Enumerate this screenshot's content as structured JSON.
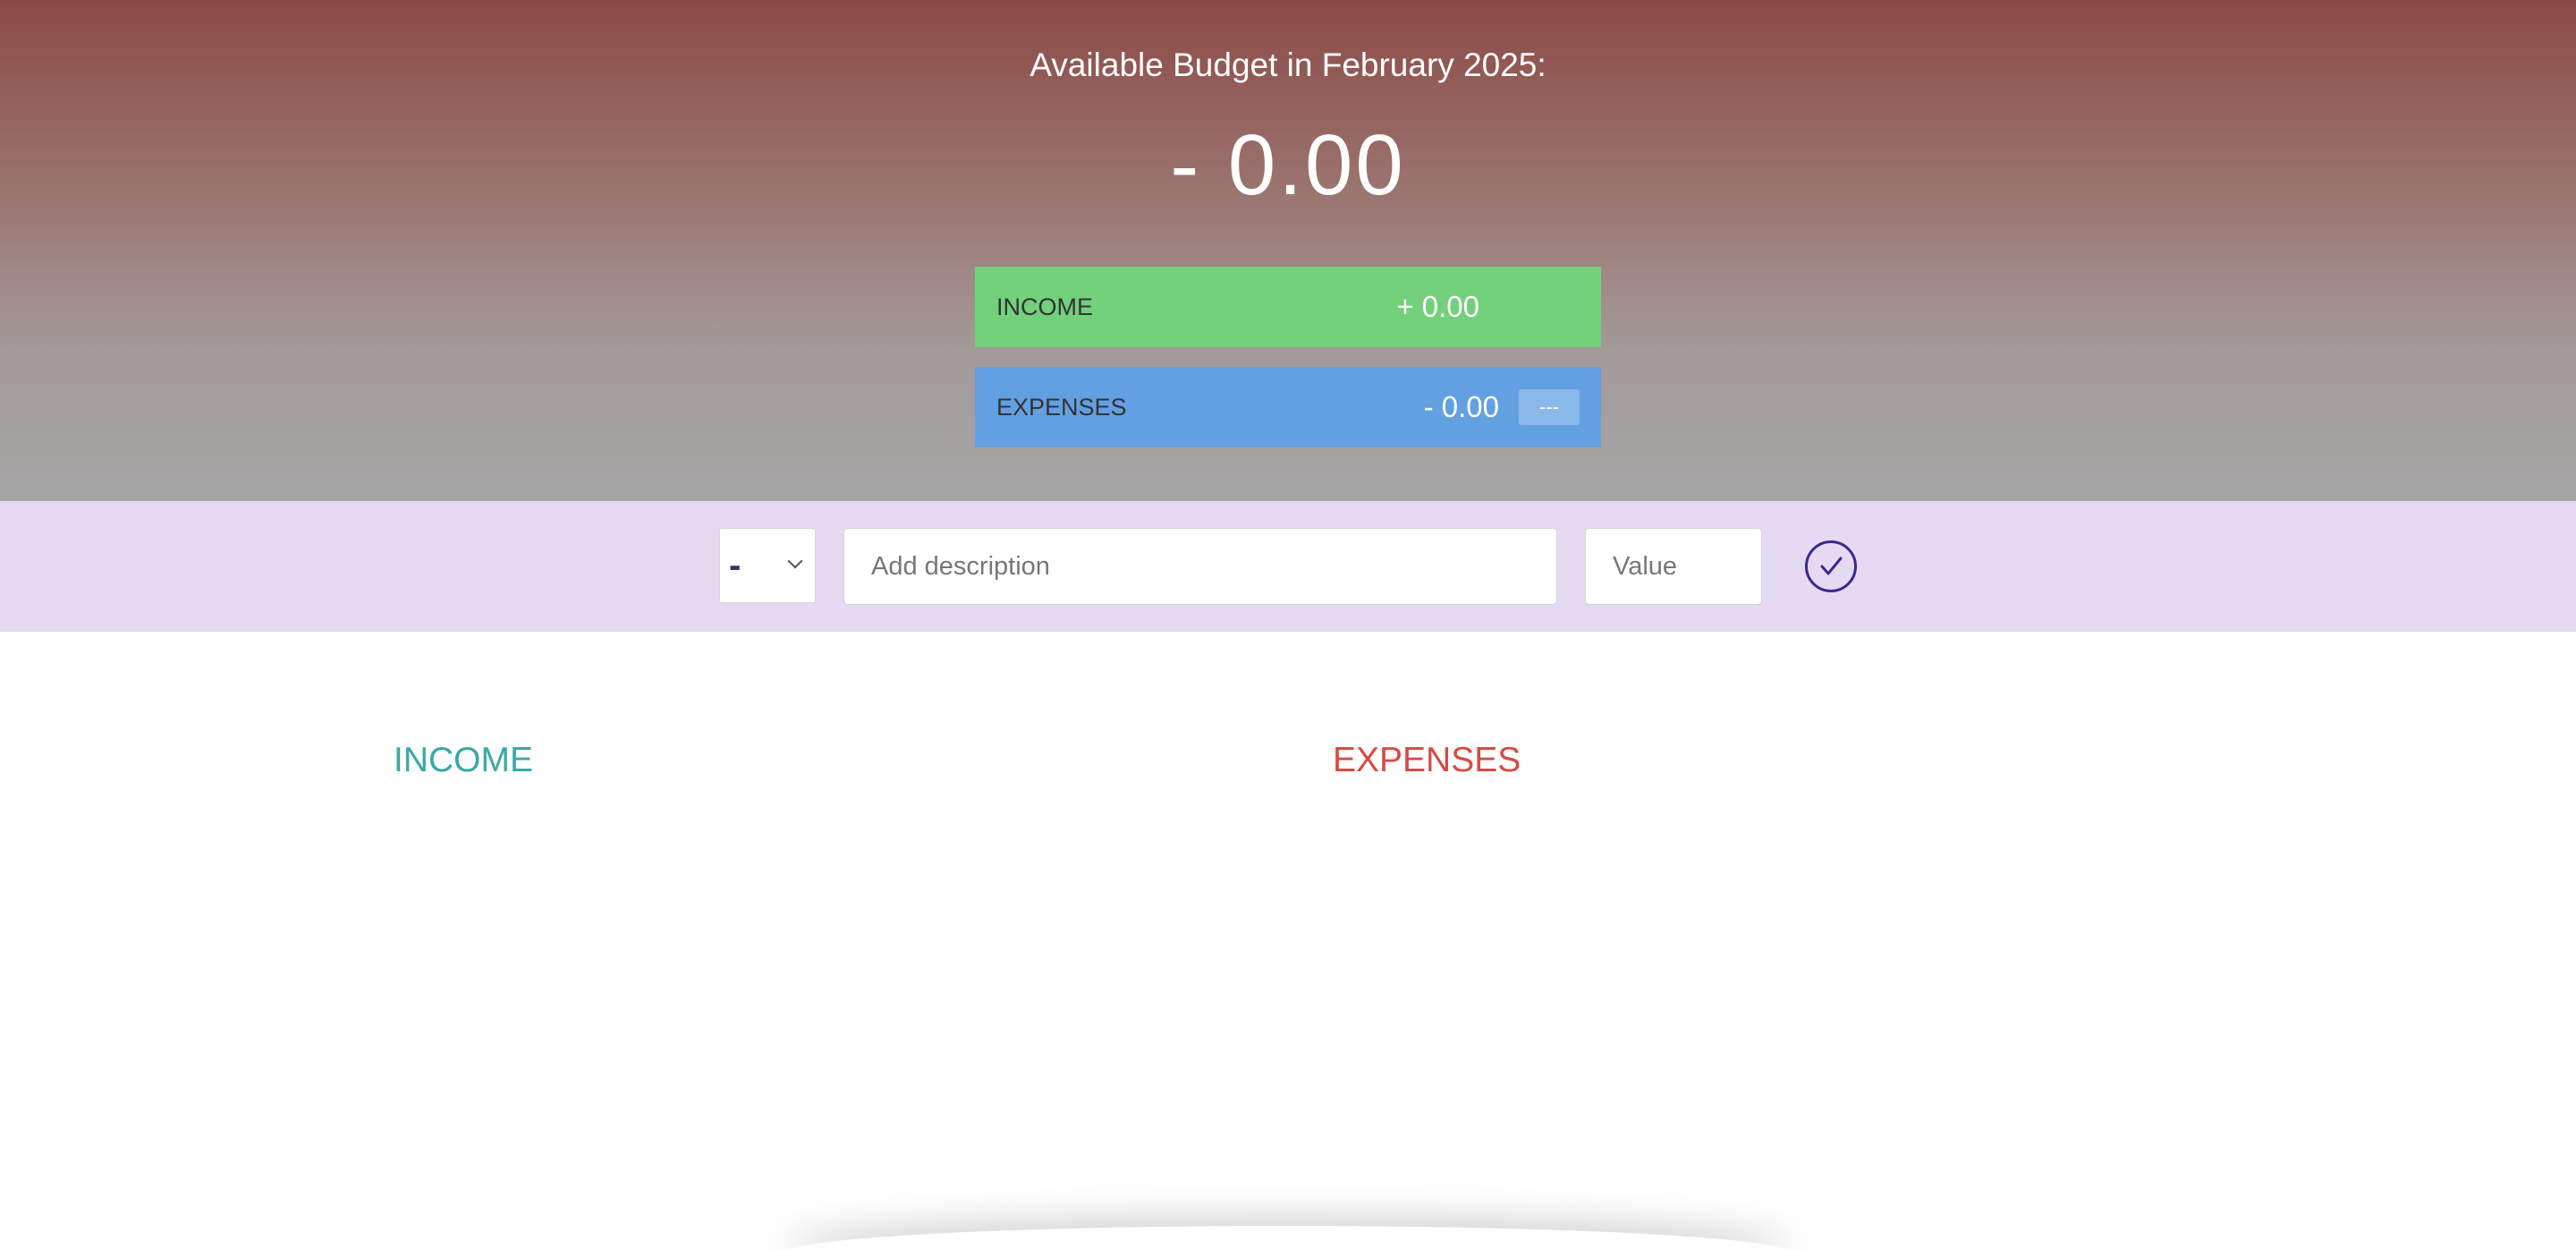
{
  "header": {
    "title": "Available Budget in February 2025:",
    "budget_value": "- 0.00"
  },
  "summary": {
    "income": {
      "label": "INCOME",
      "value": "+ 0.00"
    },
    "expenses": {
      "label": "EXPENSES",
      "value": "- 0.00",
      "percentage": "---"
    }
  },
  "add_form": {
    "type_selected": "-",
    "description_placeholder": "Add description",
    "value_placeholder": "Value",
    "submit_icon": "checkmark-circle-icon"
  },
  "lists": {
    "income_title": "INCOME",
    "expenses_title": "EXPENSES"
  },
  "colors": {
    "income_accent": "#73d07b",
    "expenses_accent": "#63a0e1",
    "income_title": "#3ba8a5",
    "expenses_title": "#d64b43",
    "add_bar_bg": "#e6daf2",
    "button_color": "#3d2794"
  }
}
